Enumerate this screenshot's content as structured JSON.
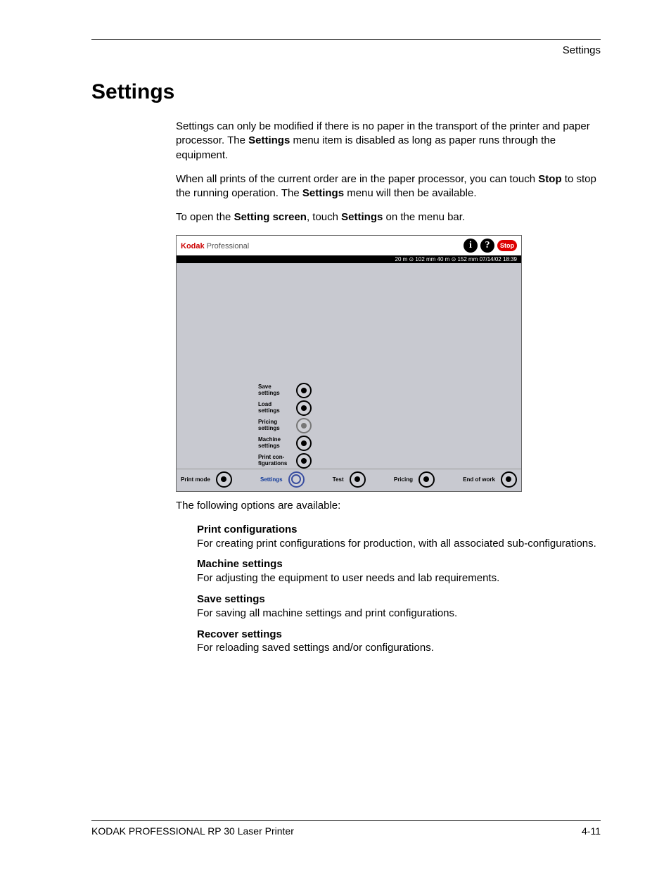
{
  "header_label": "Settings",
  "title": "Settings",
  "p1a": "Settings can only be modified if there is no paper in the transport of the printer and paper processor. The ",
  "p1b": "Settings",
  "p1c": " menu item is disabled as long as paper runs through the equipment.",
  "p2a": "When all prints of the current order are in the paper processor, you can touch ",
  "p2b": "Stop",
  "p2c": " to stop the running operation. The ",
  "p2d": "Settings",
  "p2e": " menu will then be available.",
  "p3a": "To open the ",
  "p3b": "Setting screen",
  "p3c": ", touch ",
  "p3d": "Settings",
  "p3e": " on the menu bar.",
  "device": {
    "brand_k": "Kodak",
    "brand_p": " Professional",
    "info_glyph": "i",
    "help_glyph": "?",
    "stop_label": "Stop",
    "status": "20 m ⊙ 102 mm   40 m ⊙ 152 mm  07/14/02     18:39",
    "menu": {
      "save": "Save\nsettings",
      "load": "Load\nsettings",
      "pricing": "Pricing\nsettings",
      "machine": "Machine\nsettings",
      "printconf": "Print con-\nfigurations"
    },
    "tabs": {
      "printmode": "Print mode",
      "settings": "Settings",
      "test": "Test",
      "pricing": "Pricing",
      "endofwork": "End of work"
    }
  },
  "options_intro": "The following options are available:",
  "options": {
    "printconf_h": "Print configurations",
    "printconf_t": "For creating print configurations for production, with all associated sub-configurations.",
    "machine_h": "Machine settings",
    "machine_t": "For adjusting the equipment to user needs and lab requirements.",
    "save_h": "Save settings",
    "save_t": "For saving all machine settings and print configurations.",
    "recover_h": "Recover settings",
    "recover_t": "For reloading saved settings and/or configurations."
  },
  "footer_left": "KODAK PROFESSIONAL RP 30 Laser Printer",
  "footer_right": "4-11"
}
